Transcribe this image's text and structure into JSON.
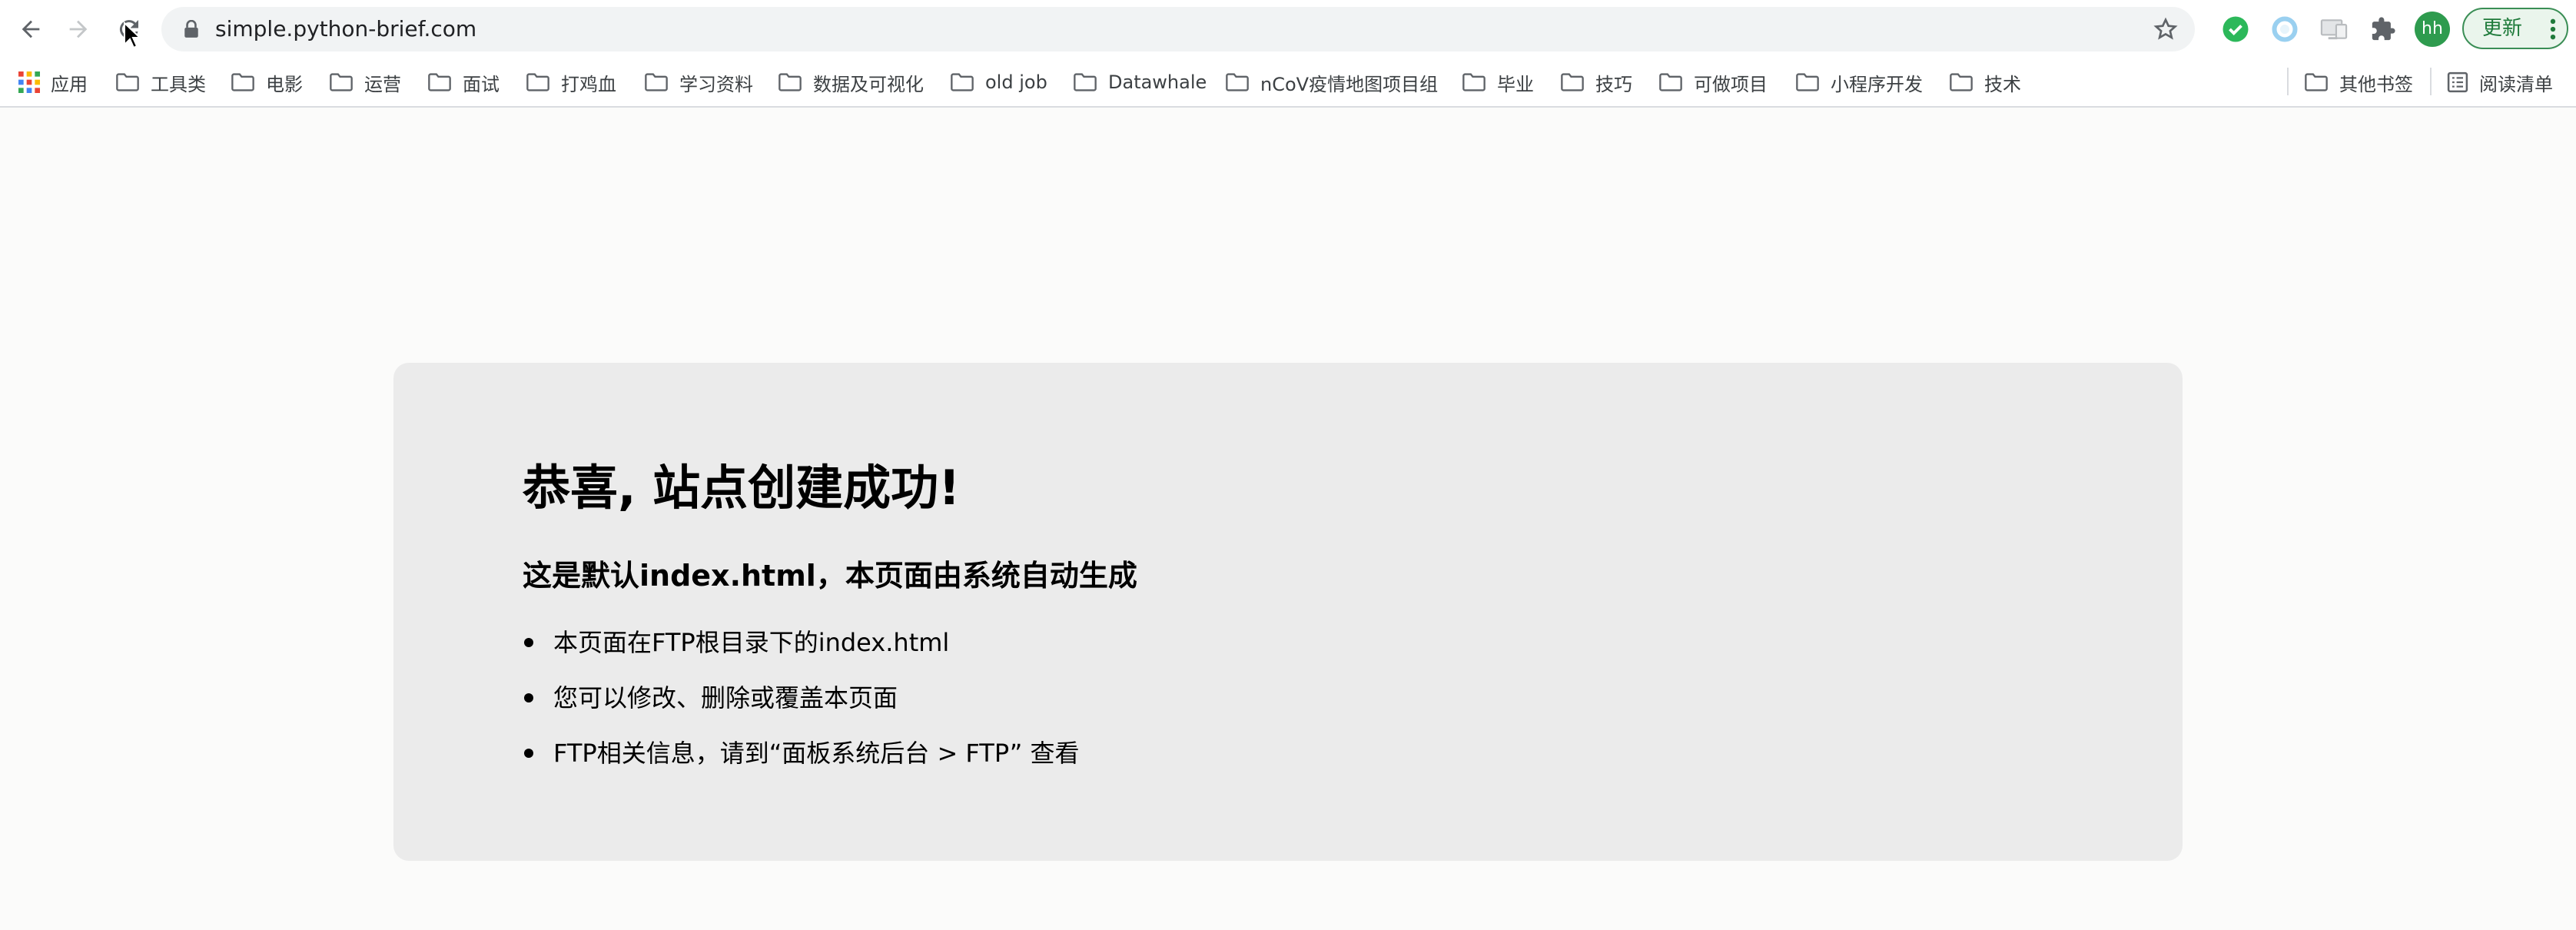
{
  "browser": {
    "url": "simple.python-brief.com",
    "avatar_initials": "hh",
    "update_label": "更新",
    "accent": "#2e9b4e"
  },
  "bookmarks": {
    "apps_label": "应用",
    "folders": [
      "工具类",
      "电影",
      "运营",
      "面试",
      "打鸡血",
      "学习资料",
      "数据及可视化",
      "old job",
      "Datawhale",
      "nCoV疫情地图项目组",
      "毕业",
      "技巧",
      "可做项目",
      "小程序开发",
      "技术"
    ],
    "other_label": "其他书签",
    "reading_list_label": "阅读清单"
  },
  "page": {
    "heading": "恭喜, 站点创建成功!",
    "subheading": "这是默认index.html，本页面由系统自动生成",
    "items": [
      "本页面在FTP根目录下的index.html",
      "您可以修改、删除或覆盖本页面",
      "FTP相关信息，请到“面板系统后台 > FTP” 查看"
    ]
  }
}
